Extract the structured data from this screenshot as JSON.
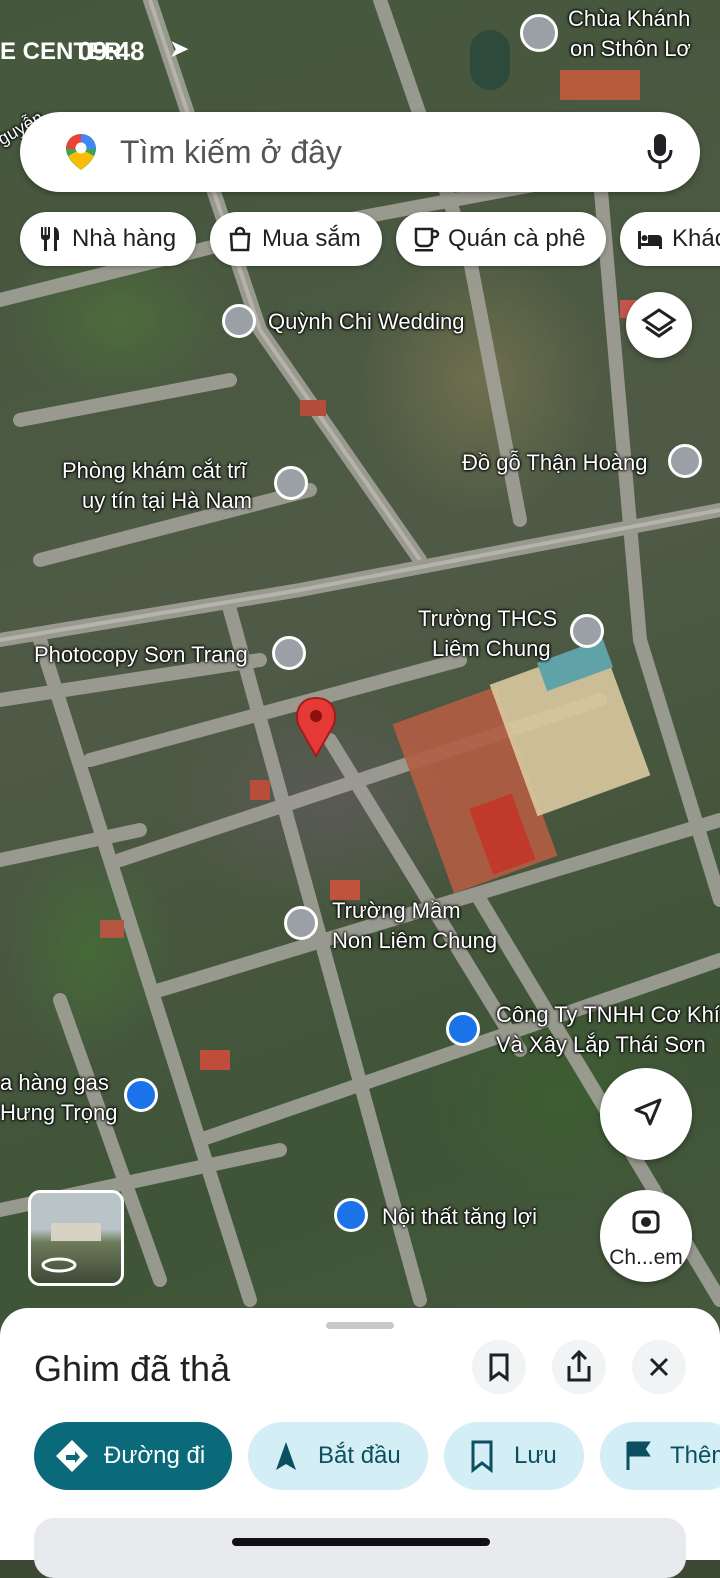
{
  "status": {
    "carrier": "E CENTER",
    "time": "09:48",
    "right_text": "on Sthôn Lơ"
  },
  "search": {
    "placeholder": "Tìm kiếm ở đây"
  },
  "chips": [
    {
      "label": "Nhà hàng",
      "icon": "restaurant-icon"
    },
    {
      "label": "Mua sắm",
      "icon": "shopping-bag-icon"
    },
    {
      "label": "Quán cà phê",
      "icon": "coffee-icon"
    },
    {
      "label": "Khác",
      "icon": "hotel-bed-icon"
    }
  ],
  "map_labels": {
    "chua": "Chùa Khánh",
    "chua2": "on Sthôn Lơ",
    "quynh": "Quỳnh Chi Wedding",
    "phong1": "Phòng khám cắt trĩ",
    "phong2": "uy tín tại Hà Nam",
    "dogo": "Đồ gỗ Thận Hoàng",
    "thcs1": "Trường THCS",
    "thcs2": "Liêm Chung",
    "photo": "Photocopy Sơn Trang",
    "mamnon1": "Trường Mầm",
    "mamnon2": "Non Liêm Chung",
    "cty1": "Công Ty TNHH Cơ Khí",
    "cty2": "Và Xây Lắp Thái Sơn",
    "gas1": "a hàng gas",
    "gas2": "Hưng Trọng",
    "noithat": "Nội thất tăng lợi",
    "street": "guyễn"
  },
  "controls": {
    "camera_label": "Ch...em"
  },
  "sheet": {
    "title": "Ghim đã thả",
    "actions": [
      {
        "label": "Đường đi",
        "icon": "directions-icon"
      },
      {
        "label": "Bắt đầu",
        "icon": "navigation-arrow-icon"
      },
      {
        "label": "Lưu",
        "icon": "bookmark-icon"
      },
      {
        "label": "Thêm",
        "icon": "flag-icon"
      }
    ]
  },
  "colors": {
    "accent": "#0b6a7a",
    "pin": "#e53935",
    "poi_gray": "#9aa0a6",
    "poi_blue": "#1a73e8"
  }
}
